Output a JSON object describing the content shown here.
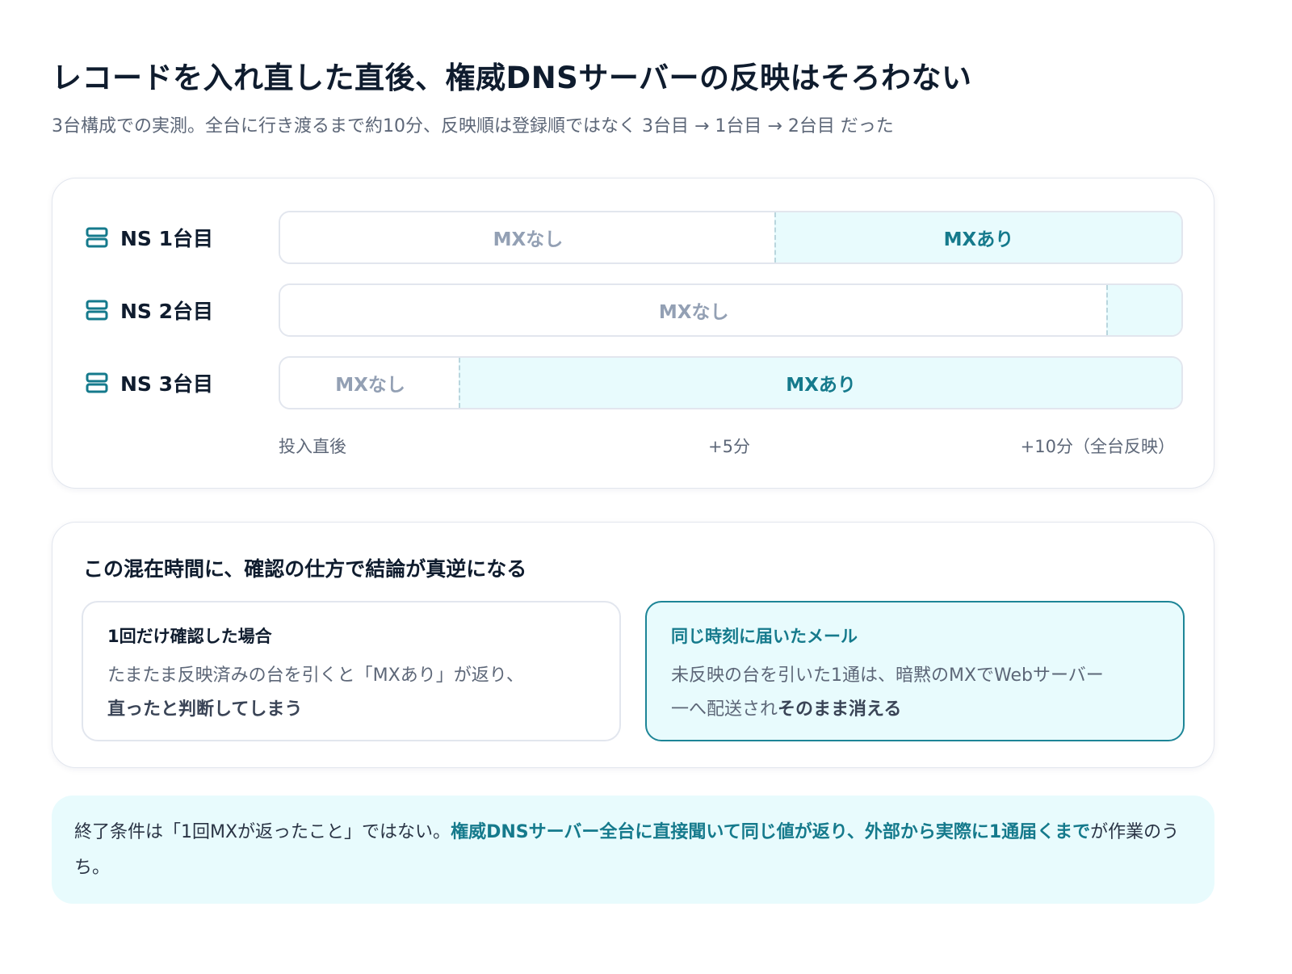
{
  "title": "レコードを入れ直した直後、権威DNSサーバーの反映はそろわない",
  "subtitle": "3台構成での実測。全台に行き渡るまで約10分、反映順は登録順ではなく 3台目 → 1台目 → 2台目 だった",
  "timeline": {
    "servers": [
      {
        "label": "NS 1台目",
        "icon": "server-icon",
        "switch_fraction": 0.55,
        "before_label": "MXなし",
        "after_label": "MXあり"
      },
      {
        "label": "NS 2台目",
        "icon": "server-icon",
        "switch_fraction": 0.918,
        "before_label": "MXなし",
        "after_label": ""
      },
      {
        "label": "NS 3台目",
        "icon": "server-icon",
        "switch_fraction": 0.2,
        "before_label": "MXなし",
        "after_label": "MXあり"
      }
    ],
    "axis": {
      "start": "投入直後",
      "mid": "+5分",
      "end": "+10分（全台反映）"
    }
  },
  "comparison": {
    "heading": "この混在時間に、確認の仕方で結論が真逆になる",
    "left": {
      "title": "1回だけ確認した場合",
      "body_plain": "たまたま反映済みの台を引くと「MXあり」が返り、",
      "body_bold": "直ったと判断してしまう"
    },
    "right": {
      "title": "同じ時刻に届いたメール",
      "body_plain": "未反映の台を引いた1通は、暗黙のMXでWebサーバー",
      "body_plain2": "一へ配送され",
      "body_bold": "そのまま消える"
    }
  },
  "conclusion": {
    "plain_start": "終了条件は「1回MXが返ったこと」ではない。",
    "highlight": "権威DNSサーバー全台に直接聞いて同じ値が返り、外部から実際に1通届くまで",
    "plain_end": "が作業のうち。"
  },
  "colors": {
    "accent": "#157a8c",
    "accent_bg": "#e8fbfd",
    "muted": "#93a0b4",
    "border": "#e2e6ee"
  }
}
